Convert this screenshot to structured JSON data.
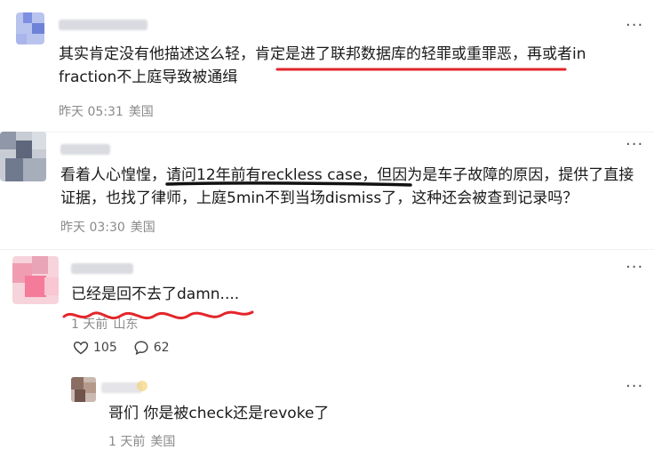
{
  "comments": [
    {
      "text_line1": "其实肯定没有他描述这么轻，肯定是进了联邦数据库的轻罪或重罪恶，再或者in",
      "text_line2": "fraction不上庭导致被通缉",
      "time": "昨天 05:31",
      "location": "美国",
      "underline_color": "#e3262b"
    },
    {
      "text_line1": "看着人心惶惶，请问12年前有reckless case，但因为是车子故障的原因，提供了直接",
      "text_line2": "证据，也找了律师，上庭5min不到当场dismiss了，这种还会被查到记录吗？",
      "time": "昨天 03:30",
      "location": "美国",
      "underline_color": "#111111"
    },
    {
      "text_line1": "已经是回不去了damn....",
      "time": "1 天前",
      "location": "山东",
      "likes": "105",
      "comments_count": "62",
      "underline_color": "#e3262b"
    }
  ],
  "reply": {
    "text": "哥们 你是被check还是revoke了",
    "time": "1 天前",
    "location": "美国"
  },
  "icons": {
    "more": "more-dots-icon",
    "like": "heart-icon",
    "comment": "comment-bubble-icon"
  }
}
